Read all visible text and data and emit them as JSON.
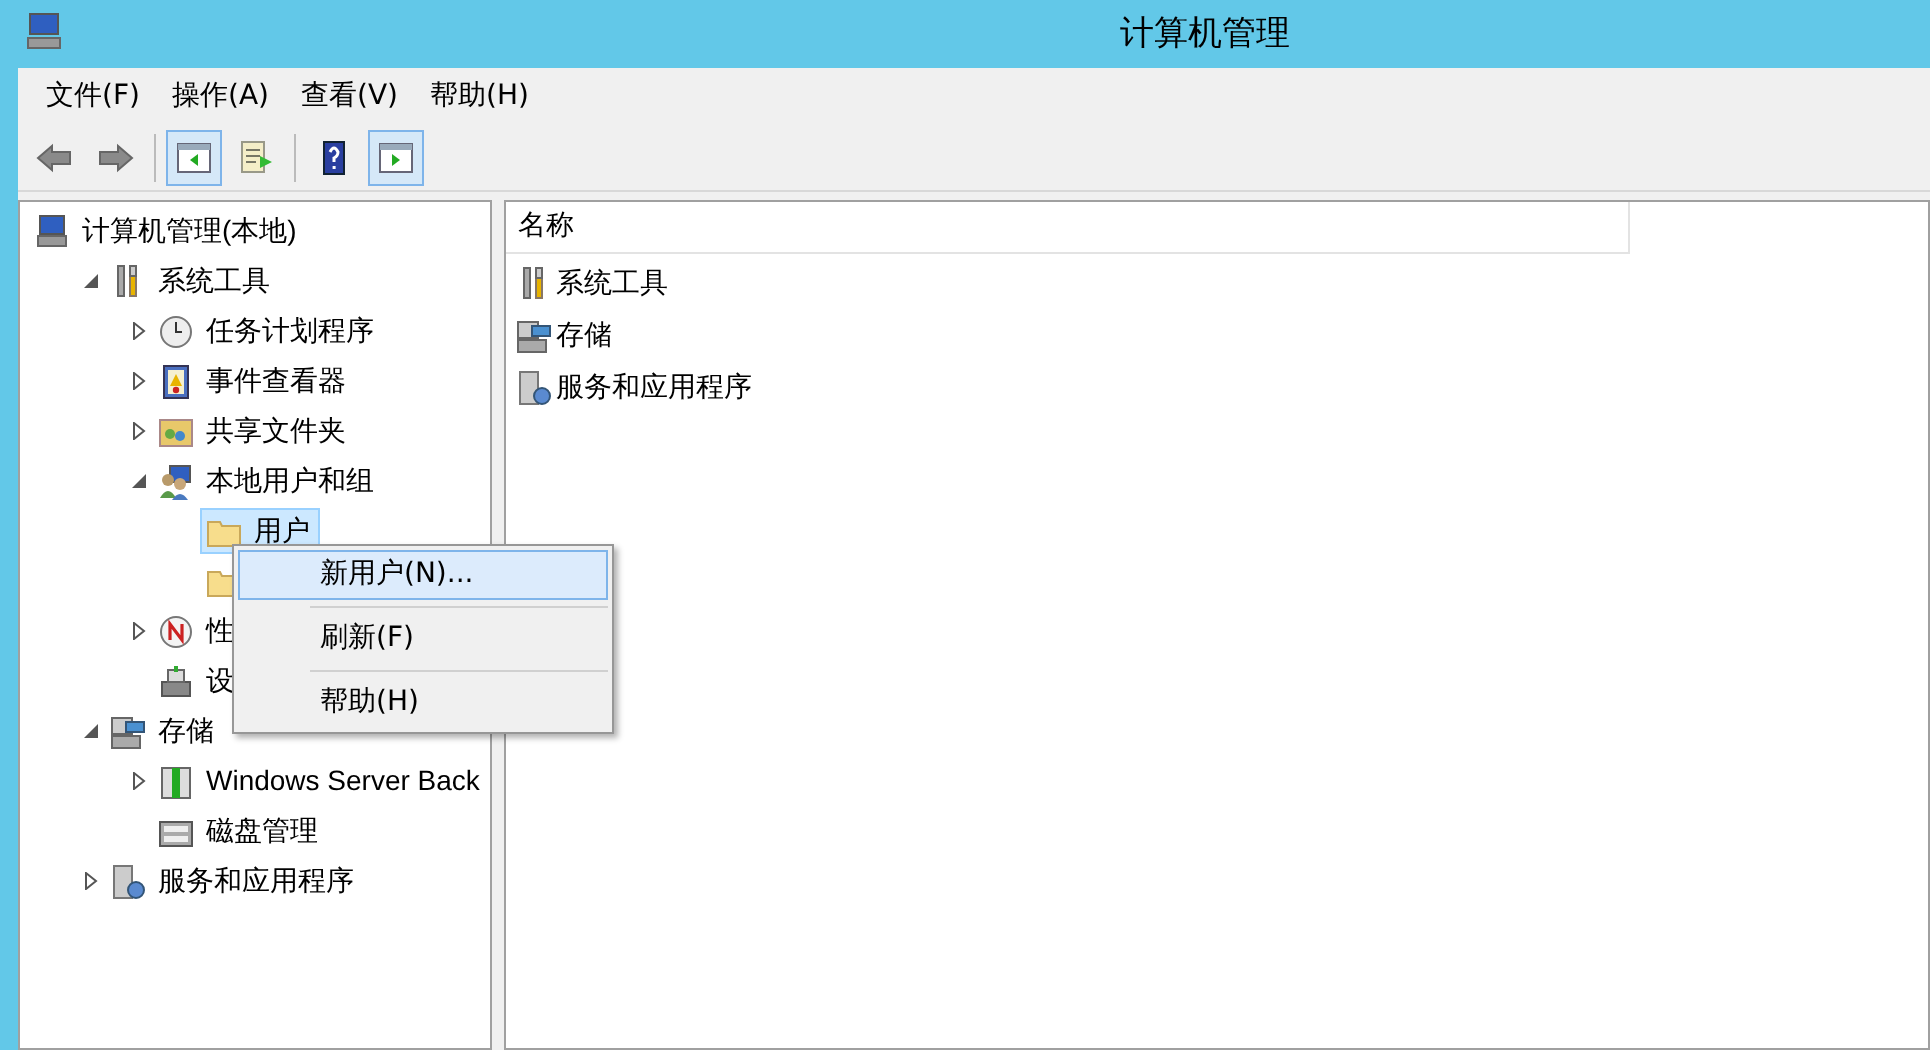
{
  "window": {
    "title": "计算机管理"
  },
  "menu_bar": [
    "文件(F)",
    "操作(A)",
    "查看(V)",
    "帮助(H)"
  ],
  "toolbar": [
    {
      "pressed": false
    },
    {
      "pressed": false
    },
    {
      "pressed": true
    },
    {
      "pressed": false
    },
    {
      "pressed": false
    },
    {
      "pressed": true
    }
  ],
  "tree": [
    {
      "label": "计算机管理(本地)",
      "selected": false,
      "children": [
        {
          "label": "系统工具",
          "selected": false,
          "expanded": true,
          "children": [
            {
              "label": "任务计划程序",
              "selected": false,
              "expanded": false
            },
            {
              "label": "事件查看器",
              "selected": false,
              "expanded": false
            },
            {
              "label": "共享文件夹",
              "selected": false,
              "expanded": false
            },
            {
              "label": "本地用户和组",
              "selected": false,
              "expanded": true,
              "children": [
                {
                  "label": "用户",
                  "selected": true
                },
                {
                  "selected": false
                }
              ]
            },
            {
              "label": "性",
              "selected": false,
              "expanded": false
            },
            {
              "label": "设",
              "selected": false
            }
          ]
        },
        {
          "label": "存储",
          "selected": false,
          "expanded": true,
          "children": [
            {
              "label": "Windows Server Back",
              "selected": false,
              "expanded": false
            },
            {
              "label": "磁盘管理",
              "selected": false
            }
          ]
        },
        {
          "label": "服务和应用程序",
          "selected": false,
          "expanded": false
        }
      ]
    }
  ],
  "list": {
    "columns": [
      "名称"
    ],
    "rows": [
      "系统工具",
      "存储",
      "服务和应用程序"
    ]
  },
  "context_menu": [
    {
      "label": "新用户(N)...",
      "selected": true
    },
    {
      "label": "刷新(F)",
      "selected": false
    },
    {
      "label": "帮助(H)",
      "selected": false
    }
  ]
}
